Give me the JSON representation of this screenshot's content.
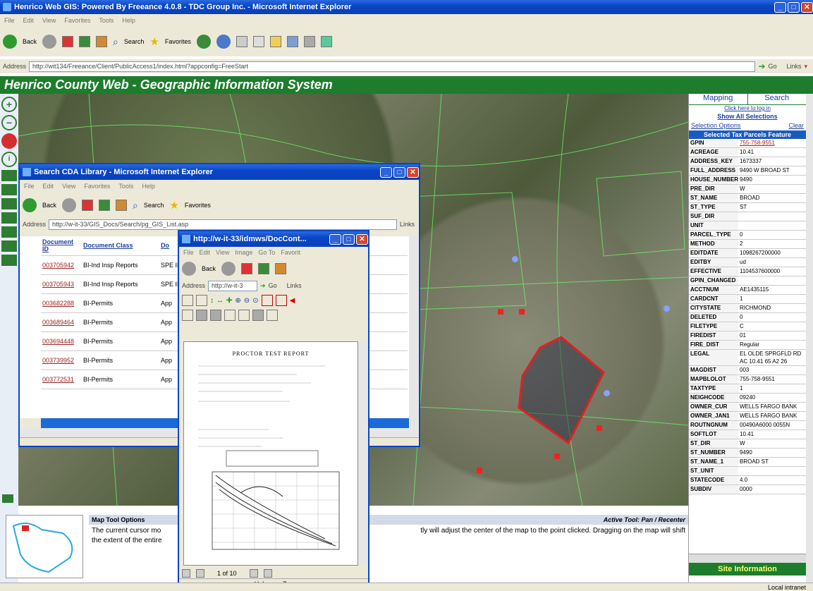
{
  "main_window": {
    "title": "Henrico Web GIS: Powered By Freeance 4.0.8 - TDC Group Inc. - Microsoft Internet Explorer",
    "menu": [
      "File",
      "Edit",
      "View",
      "Favorites",
      "Tools",
      "Help"
    ],
    "toolbar": {
      "back": "Back",
      "search": "Search",
      "favorites": "Favorites"
    },
    "address_label": "Address",
    "address": "http://wit134/Freeance/Client/PublicAccess1/index.html?appconfig=FreeStart",
    "go": "Go",
    "links": "Links"
  },
  "banner": {
    "title": "Henrico County Web - Geographic Information System"
  },
  "right_panel": {
    "tab_mapping": "Mapping",
    "tab_search": "Search",
    "login": "Click here to log in",
    "show_all": "Show All Selections",
    "selection_options": "Selection Options",
    "clear": "Clear",
    "feature_header": "Selected Tax Parcels Feature",
    "attributes": [
      {
        "k": "GPIN",
        "v": "755-758-9551"
      },
      {
        "k": "ACREAGE",
        "v": "10.41"
      },
      {
        "k": "ADDRESS_KEY",
        "v": "1673337"
      },
      {
        "k": "FULL_ADDRESS",
        "v": "9490 W BROAD ST"
      },
      {
        "k": "HOUSE_NUMBER",
        "v": "9490"
      },
      {
        "k": "PRE_DIR",
        "v": "W"
      },
      {
        "k": "ST_NAME",
        "v": "BROAD"
      },
      {
        "k": "ST_TYPE",
        "v": "ST"
      },
      {
        "k": "SUF_DIR",
        "v": ""
      },
      {
        "k": "UNIT",
        "v": ""
      },
      {
        "k": "PARCEL_TYPE",
        "v": "0"
      },
      {
        "k": "METHOD",
        "v": "2"
      },
      {
        "k": "EDITDATE",
        "v": "1098267200000"
      },
      {
        "k": "EDITBY",
        "v": "ud"
      },
      {
        "k": "EFFECTIVE",
        "v": "1104537600000"
      },
      {
        "k": "GPIN_CHANGED",
        "v": ""
      },
      {
        "k": "ACCTNUM",
        "v": "AE1435115"
      },
      {
        "k": "CARDCNT",
        "v": "1"
      },
      {
        "k": "CITYSTATE",
        "v": "RICHMOND"
      },
      {
        "k": "DELETED",
        "v": "0"
      },
      {
        "k": "FILETYPE",
        "v": "C"
      },
      {
        "k": "FIREDIST",
        "v": "01"
      },
      {
        "k": "FIRE_DIST",
        "v": "Regular"
      },
      {
        "k": "LEGAL",
        "v": "EL OLDE SPRGFLD RD AC 10.41 65 A2 26"
      },
      {
        "k": "MAGDIST",
        "v": "003"
      },
      {
        "k": "MAPBLOLOT",
        "v": "755-758-9551"
      },
      {
        "k": "TAXTYPE",
        "v": "1"
      },
      {
        "k": "NEIGHCODE",
        "v": "09240"
      },
      {
        "k": "OWNER_CUR",
        "v": "WELLS FARGO BANK"
      },
      {
        "k": "OWNER_JAN1",
        "v": "WELLS FARGO BANK"
      },
      {
        "k": "ROUTNGNUM",
        "v": "00490A6000 0055N"
      },
      {
        "k": "SOFTLOT",
        "v": "10.41"
      },
      {
        "k": "ST_DIR",
        "v": "W"
      },
      {
        "k": "ST_NUMBER",
        "v": "9490"
      },
      {
        "k": "ST_NAME_1",
        "v": "BROAD ST"
      },
      {
        "k": "ST_UNIT",
        "v": ""
      },
      {
        "k": "STATECODE",
        "v": "4.0"
      },
      {
        "k": "SUBDIV",
        "v": "0000"
      }
    ],
    "site_info": "Site Information"
  },
  "bottom": {
    "map_tool_options": "Map Tool Options",
    "active_tool": "Active Tool: Pan / Recenter",
    "text1": "The current cursor mo",
    "text1b": "tly will adjust the center of the map to the point clicked. Dragging on the map will shift",
    "text2": "the extent of the entire"
  },
  "search_window": {
    "title": "Search CDA Library - Microsoft Internet Explorer",
    "menu": [
      "File",
      "Edit",
      "View",
      "Favorites",
      "Tools",
      "Help"
    ],
    "back": "Back",
    "search": "Search",
    "favorites": "Favorites",
    "address_label": "Address",
    "address": "http://w-it-33/GIS_Docs/Search/pg_GIS_List.asp",
    "links": "Links",
    "headers": [
      "Document ID",
      "Document Class",
      "Do"
    ],
    "rows": [
      {
        "id": "003705942",
        "cls": "BI-Ind Insp Reports",
        "d": "SPE INSP"
      },
      {
        "id": "003705943",
        "cls": "BI-Ind Insp Reports",
        "d": "SPE INSP"
      },
      {
        "id": "003682288",
        "cls": "BI-Permits",
        "d": "App"
      },
      {
        "id": "003689464",
        "cls": "BI-Permits",
        "d": "App"
      },
      {
        "id": "003694448",
        "cls": "BI-Permits",
        "d": "App"
      },
      {
        "id": "003739952",
        "cls": "BI-Permits",
        "d": "App"
      },
      {
        "id": "003772531",
        "cls": "BI-Permits",
        "d": "App"
      }
    ]
  },
  "doc_window": {
    "title": "http://w-it-33/idmws/DocCont...",
    "menu": [
      "File",
      "Edit",
      "View",
      "Image",
      "Go To",
      "Favorit"
    ],
    "back": "Back",
    "address_label": "Address",
    "address": "http://w-it-3",
    "go": "Go",
    "links": "Links",
    "doc_title": "PROCTOR TEST REPORT",
    "page": "1 of 10",
    "zone": "Unknown Zone"
  },
  "status": {
    "zone": "Local intranet"
  }
}
